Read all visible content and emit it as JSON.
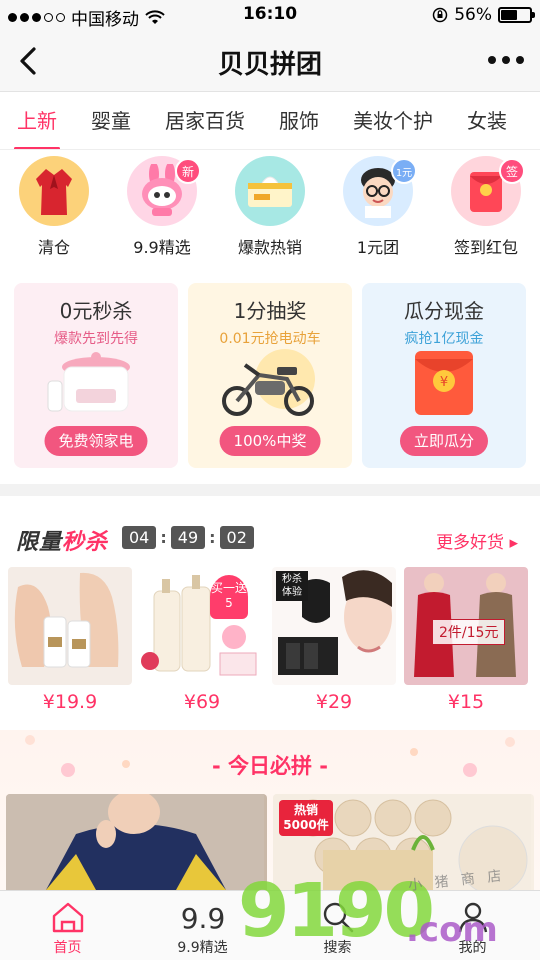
{
  "status_bar": {
    "carrier": "中国移动",
    "time": "16:10",
    "battery": "56%",
    "battery_level": 0.56
  },
  "nav": {
    "title": "贝贝拼团"
  },
  "tabs": [
    {
      "label": "上新",
      "active": true
    },
    {
      "label": "婴童"
    },
    {
      "label": "居家百货"
    },
    {
      "label": "服饰"
    },
    {
      "label": "美妆个护"
    },
    {
      "label": "女装"
    }
  ],
  "icons": [
    {
      "label": "清仓",
      "icon": "red-coat-icon"
    },
    {
      "label": "9.9精选",
      "icon": "bunny-mascot-icon",
      "badge": "新"
    },
    {
      "label": "爆款热销",
      "icon": "tissue-box-icon"
    },
    {
      "label": "1元团",
      "icon": "kid-glasses-icon",
      "badge": "1元"
    },
    {
      "label": "签到红包",
      "icon": "red-envelope-icon",
      "badge": "签"
    }
  ],
  "promos": [
    {
      "title": "0元秒杀",
      "subtitle": "爆款先到先得",
      "button": "免费领家电",
      "bg": "#fdeef3",
      "accent": "#f2567f"
    },
    {
      "title": "1分抽奖",
      "subtitle": "0.01元抢电动车",
      "button": "100%中奖",
      "bg": "#fff6e3",
      "accent": "#f2567f"
    },
    {
      "title": "瓜分现金",
      "subtitle": "疯抢1亿现金",
      "button": "立即瓜分",
      "bg": "#eaf4fd",
      "accent": "#f2567f"
    }
  ],
  "flash_sale": {
    "title_a": "限量",
    "title_b": "秒杀",
    "countdown": [
      "04",
      "49",
      "02"
    ],
    "more_label": "更多好货 ▸",
    "products": [
      {
        "price": "¥19.9",
        "icon": "foot-cream-icon"
      },
      {
        "price": "¥69",
        "icon": "shampoo-bottles-icon",
        "tag": "买一送5"
      },
      {
        "price": "¥29",
        "icon": "face-mask-icon",
        "tag": "秒杀 体验"
      },
      {
        "price": "¥15",
        "icon": "winter-coats-icon",
        "tag": "2件/15元"
      }
    ]
  },
  "today": {
    "title": "- 今日必拼 -",
    "cards": [
      {
        "icon": "sweater-photo-icon"
      },
      {
        "icon": "toilet-paper-icon",
        "tag": "热销 5000件"
      },
      {
        "icon": "puff-pad-icon"
      }
    ]
  },
  "tabbar": [
    {
      "label": "首页",
      "icon": "home-icon",
      "active": true
    },
    {
      "label": "9.9精选",
      "icon": "nine-nine-icon"
    },
    {
      "label": "搜索",
      "icon": "search-icon"
    },
    {
      "label": "我的",
      "icon": "profile-icon"
    }
  ],
  "watermark": {
    "big": "9190",
    "com": ".com",
    "small": "小 猪 商 店"
  },
  "colors": {
    "accent": "#ff3366",
    "divider": "#f2f2f2"
  }
}
